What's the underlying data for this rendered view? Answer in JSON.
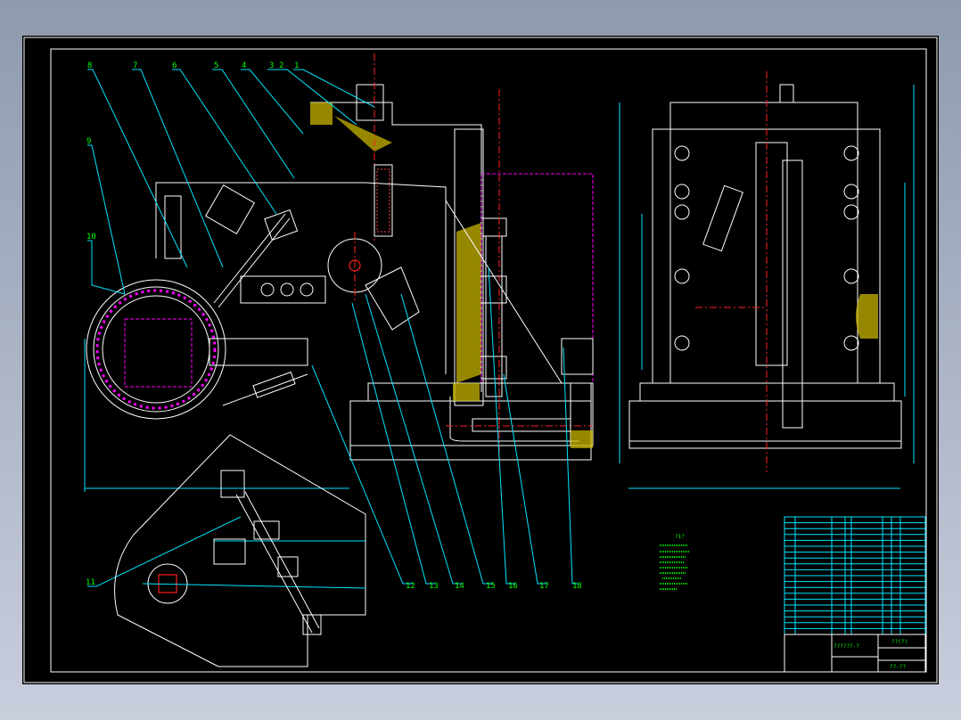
{
  "drawing": {
    "balloons_top": [
      "8",
      "7",
      "6",
      "5",
      "4",
      "3",
      "2",
      "1"
    ],
    "balloons_left": [
      "9",
      "10",
      "11"
    ],
    "balloons_bottom": [
      "12",
      "13",
      "14",
      "15",
      "16",
      "17",
      "18"
    ],
    "notes_title": "?1?",
    "title_block_name": "??(?)",
    "title_block_code": "??????-?",
    "title_block_org": "??-??",
    "parts_rows": 19
  },
  "colors": {
    "background": "#000000",
    "outline": "#ffffff",
    "dimension": "#00e5ff",
    "center_line": "#ff2020",
    "hidden": "#ff00ff",
    "text": "#00ff00"
  }
}
